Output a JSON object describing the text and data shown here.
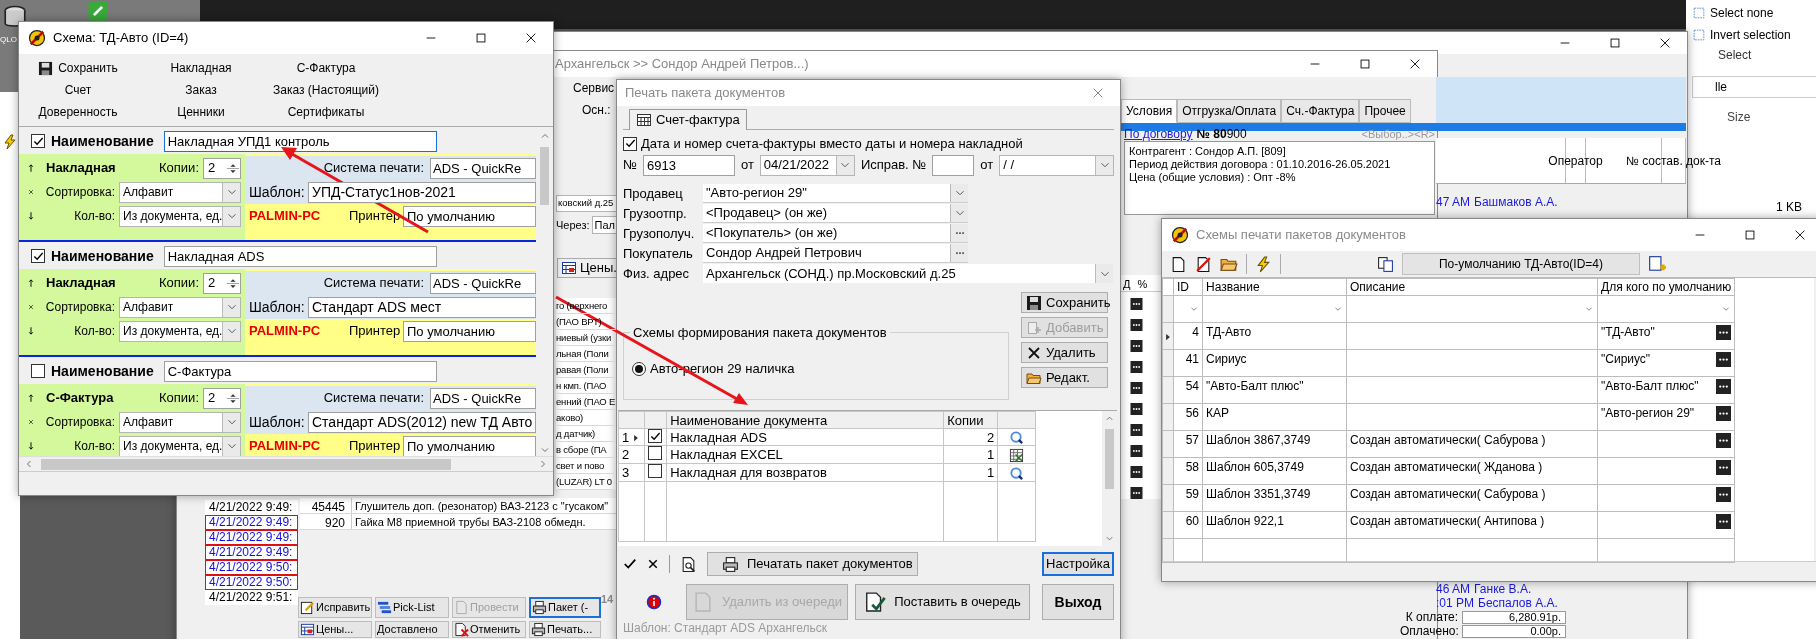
{
  "desktop": {
    "icon_label": "QLO"
  },
  "explorer": {
    "commands": [
      "Select none",
      "Invert selection"
    ],
    "group_label": "Select",
    "search_text": "lle",
    "column": "Size",
    "file_size": "1 KB"
  },
  "app_window": {
    "doc_title": "Архангельск >> Сондор Андрей Петров...)",
    "menu": [
      "Сервис"
    ],
    "base_label": "Осн.:",
    "address_fragment": "ковский д.25",
    "via_label": "Через:",
    "via_value": "Пал",
    "prices_button": "Цены.",
    "product_fragments": [
      "го (верхнего",
      "(ПАО ВРТ)",
      "ниевый (узки",
      "льная (Поли",
      "равая (Поли",
      "н кмп. (ПАО",
      "енний (ПАО Е",
      "аково)",
      "д датчик)",
      "в сборе (ПА",
      "свет и пово",
      "(LUZAR) LT 0"
    ],
    "products": [
      {
        "code": "45445",
        "name": "Глушитель доп. (резонатор) ВАЗ-2123 с \"гусаком\""
      },
      {
        "code": "920",
        "name": "Гайка  М8 приемной трубы ВАЗ-2108 обмедн."
      }
    ],
    "times": [
      {
        "text": "4/21/2022 9:49:",
        "flagged": false
      },
      {
        "text": "4/21/2022 9:49:",
        "flagged": true
      },
      {
        "text": "4/21/2022 9:49:",
        "flagged": true
      },
      {
        "text": "4/21/2022 9:49:",
        "flagged": true
      },
      {
        "text": "4/21/2022 9:50:",
        "flagged": true
      },
      {
        "text": "4/21/2022 9:50:",
        "flagged": true
      },
      {
        "text": "4/21/2022 9:51:",
        "flagged": false
      }
    ],
    "actions": [
      {
        "label": "Исправить",
        "disabled": false,
        "focused": false
      },
      {
        "label": "Pick-List",
        "disabled": false,
        "focused": false
      },
      {
        "label": "Провести",
        "disabled": true,
        "focused": false
      },
      {
        "label": "Пакет (-",
        "disabled": false,
        "focused": true
      },
      {
        "label": "Цены...",
        "disabled": false,
        "focused": false
      },
      {
        "label": "Доставлено",
        "disabled": false,
        "focused": false
      },
      {
        "label": "Отменить",
        "disabled": false,
        "focused": false
      },
      {
        "label": "Печать...",
        "disabled": false,
        "focused": false
      }
    ],
    "page_count": "14",
    "tabs": [
      {
        "label": "Условия",
        "selected": true
      },
      {
        "label": "Отгрузка/Оплата",
        "selected": false
      },
      {
        "label": "Сч.-Фактура",
        "selected": false
      },
      {
        "label": "Прочее",
        "selected": false
      }
    ],
    "contract_link": "По договору",
    "contract_number": "**№ 80**900",
    "chooser": "<Выбор..><R>",
    "contract_lines": [
      "Контрагент : Сондор А.П. [809]",
      "Период действия договора : 01.10.2016-26.05.2021",
      "Цена (общие условия) : Опт -8%"
    ],
    "grid_headers": [
      "Д",
      "%"
    ],
    "operator_columns": [
      "Оператор",
      "№ состав. док-та"
    ],
    "operators": [
      {
        "time": "47 AM",
        "name": "Башмаков А.А."
      },
      {
        "time": "46 AM",
        "name": "Ганке В.А."
      },
      {
        "time": ":01 PM",
        "name": "Беспалов А.А."
      }
    ],
    "totals": [
      {
        "label": "К оплате:",
        "value": "6,280.91р."
      },
      {
        "label": "Оплачено:",
        "value": "0.00р."
      }
    ]
  },
  "left_window": {
    "title": "Схема: ТД-Авто (ID=4)",
    "toolbar": [
      {
        "label": "Сохранить",
        "kind": "save"
      },
      {
        "label": "Накладная",
        "kind": "text"
      },
      {
        "label": "С-Фактура",
        "kind": "text"
      },
      {
        "label": "Счет",
        "kind": "text"
      },
      {
        "label": "Заказ",
        "kind": "text"
      },
      {
        "label": "Заказ (Настоящий)",
        "kind": "text"
      },
      {
        "label": "Доверенность",
        "kind": "text"
      },
      {
        "label": "Ценники",
        "kind": "text"
      },
      {
        "label": "Сертификаты",
        "kind": "text"
      }
    ],
    "sections": [
      {
        "checked": true,
        "focused": true,
        "name_label": "Наименование",
        "name": "Накладная УПД1 контроль",
        "doc_type": "Накладная",
        "copies_label": "Копии:",
        "copies": "2",
        "sort_label": "Сортировка:",
        "sort": "Алфавит",
        "qty_label": "Кол-во:",
        "qty": "Из документа, ед.",
        "system_label": "Система печати:",
        "system": "ADS - QuickRe",
        "template_label": "Шаблон:",
        "template": "УПД-Статус1нов-2021",
        "host": "PALMIN-PC",
        "printer_label": "Принтер",
        "printer": "По умолчанию"
      },
      {
        "checked": true,
        "focused": false,
        "name_label": "Наименование",
        "name": "Накладная ADS",
        "doc_type": "Накладная",
        "copies_label": "Копии:",
        "copies": "2",
        "sort_label": "Сортировка:",
        "sort": "Алфавит",
        "qty_label": "Кол-во:",
        "qty": "Из документа, ед.",
        "system_label": "Система печати:",
        "system": "ADS - QuickRe",
        "template_label": "Шаблон:",
        "template": "Стандарт ADS мест",
        "host": "PALMIN-PC",
        "printer_label": "Принтер",
        "printer": "По умолчанию"
      },
      {
        "checked": false,
        "focused": false,
        "name_label": "Наименование",
        "name": "С-Фактура",
        "doc_type": "С-Фактура",
        "copies_label": "Копии:",
        "copies": "2",
        "sort_label": "Сортировка:",
        "sort": "Алфавит",
        "qty_label": "Кол-во:",
        "qty": "Из документа, ед.",
        "system_label": "Система печати:",
        "system": "ADS - QuickRe",
        "template_label": "Шаблон:",
        "template": "Стандарт ADS(2012) new ТД Авто",
        "host": "PALMIN-PC",
        "printer_label": "Принтер",
        "printer": "По умолчанию"
      }
    ]
  },
  "print_dialog": {
    "title": "Печать пакета документов",
    "tab": "Счет-фактура",
    "use_invoice": {
      "label": "Дата и номер счета-фактуры вместо даты и номера накладной",
      "checked": true
    },
    "number_label": "№",
    "number": "6913",
    "date_label": "от",
    "date": "04/21/2022",
    "fix_label": "Исправ. №",
    "fix_date_label": "от",
    "fix_date": "/  /",
    "parties": [
      {
        "label": "Продавец",
        "value": "\"Авто-регион 29\"",
        "kind": "dropdown"
      },
      {
        "label": "Грузоотпр.",
        "value": "<Продавец> (он же)",
        "kind": "dropdown"
      },
      {
        "label": "Грузополуч.",
        "value": "<Покупатель> (он же)",
        "kind": "ellipsis"
      },
      {
        "label": "Покупатель",
        "value": "Сондор Андрей Петрович",
        "kind": "ellipsis"
      },
      {
        "label": "Физ. адрес",
        "value": "Архангельск (СОНД.) пр.Московский д.25",
        "kind": "wide"
      }
    ],
    "side_buttons": [
      {
        "label": "Сохранить",
        "disabled": false
      },
      {
        "label": "Добавить",
        "disabled": true
      },
      {
        "label": "Удалить",
        "disabled": false
      },
      {
        "label": "Редакт.",
        "disabled": false
      }
    ],
    "schemes_title": "Схемы формирования пакета документов",
    "schemes": [
      {
        "label": "Авто-регион 29 наличка",
        "selected": true
      }
    ],
    "grid_columns": [
      "Наименование документа",
      "Копии"
    ],
    "documents": [
      {
        "index": "1",
        "selected": true,
        "checked": true,
        "name": "Накладная ADS",
        "copies": "2",
        "kind": "preview"
      },
      {
        "index": "2",
        "selected": false,
        "checked": false,
        "name": "Накладная EXCEL",
        "copies": "1",
        "kind": "excel"
      },
      {
        "index": "3",
        "selected": false,
        "checked": false,
        "name": "Накладная для возвратов",
        "copies": "1",
        "kind": "preview"
      }
    ],
    "print_button": "Печатать пакет документов",
    "settings_button": "Настройка",
    "queue_buttons": [
      {
        "label": "Удалить из очереди",
        "disabled": true
      },
      {
        "label": "Поставить в очередь",
        "disabled": false
      }
    ],
    "exit_button": "Выход",
    "status": "Шаблон: Стандарт ADS Архангельск"
  },
  "schemes_window": {
    "title": "Схемы печати пакетов документов",
    "default_button": "По-умолчанию ТД-Авто(ID=4)",
    "columns": [
      "ID",
      "Название",
      "Описание",
      "Для кого по умолчанию"
    ],
    "rows": [
      {
        "id": "4",
        "name": "ТД-Авто",
        "default_for": "\"ТД-Авто\"",
        "selected": true
      },
      {
        "id": "41",
        "name": "Сириус",
        "default_for": "\"Сириус\"",
        "selected": false
      },
      {
        "id": "54",
        "name": "\"Авто-Балт плюс\"",
        "default_for": "\"Авто-Балт плюс\"",
        "selected": false
      },
      {
        "id": "56",
        "name": "КАР",
        "default_for": "\"Авто-регион 29\"",
        "selected": false
      },
      {
        "id": "57",
        "name": "Шаблон 3867,3749",
        "description": "Создан автоматически( Сабурова )",
        "selected": false
      },
      {
        "id": "58",
        "name": "Шаблон 605,3749",
        "description": "Создан автоматически( Жданова )",
        "selected": false
      },
      {
        "id": "59",
        "name": "Шаблон 3351,3749",
        "description": "Создан автоматически( Сабурова )",
        "selected": false
      },
      {
        "id": "60",
        "name": "Шаблон 922,1",
        "description": "Создан автоматически( Антипова )",
        "selected": false
      }
    ]
  }
}
